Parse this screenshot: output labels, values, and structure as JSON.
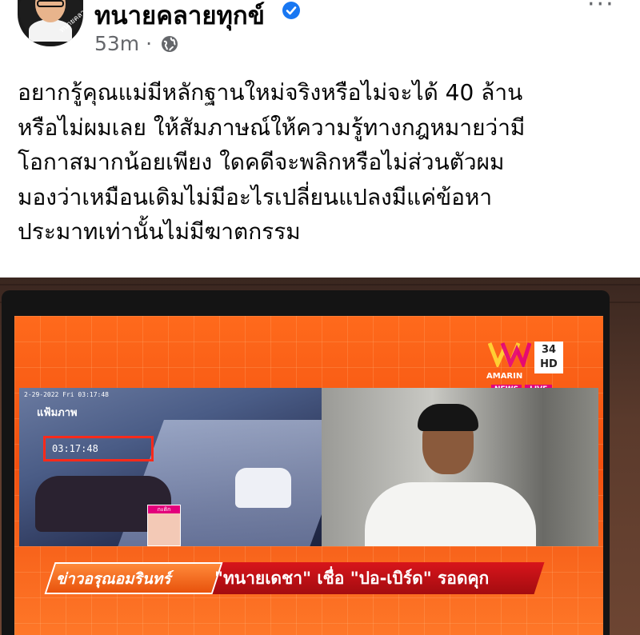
{
  "post": {
    "author_name": "ทนายคลายทุกข์",
    "avatar_caption": "ทนายคลายทุกข์",
    "verified": true,
    "time_ago": "53m",
    "separator": "·",
    "privacy_icon": "globe-icon",
    "menu_icon": "more-dots-icon",
    "menu_label": "···",
    "text_lines": [
      "อยากรู้คุณแม่มีหลักฐานใหม่จริงหรือไม่จะได้ 40 ล้าน",
      "หรือไม่ผมเลย ให้สัมภาษณ์ให้ความรู้ทางกฎหมายว่ามี",
      "โอกาสมากน้อยเพียง ใดคดีจะพลิกหรือไม่ส่วนตัวผม",
      "มองว่าเหมือนเดิมไม่มีอะไรเปลี่ยนแปลงมีแค่ข้อหา",
      "ประมาทเท่านั้นไม่มีฆาตกรรม"
    ]
  },
  "photo": {
    "channel_number": "34",
    "channel_hd": "HD",
    "channel_name": "AMARIN",
    "badge_news": "NEWS",
    "badge_live": "LIVE",
    "cctv_date": "2-29-2022 Fri 03:17:48",
    "cctv_label": "แฟ้มภาพ",
    "cctv_timestamp": "03:17:48",
    "inset_label": "กะติก",
    "program_name": "ข่าวอรุณอมรินทร์",
    "headline": "\"ทนายเดชา\" เชื่อ \"ปอ-เบิร์ด\" รอดคุก"
  },
  "colors": {
    "text_primary": "#050505",
    "text_secondary": "#65676b",
    "verified_blue": "#1877f2",
    "screen_orange": "#f2500f",
    "headline_red": "#d8151b"
  }
}
